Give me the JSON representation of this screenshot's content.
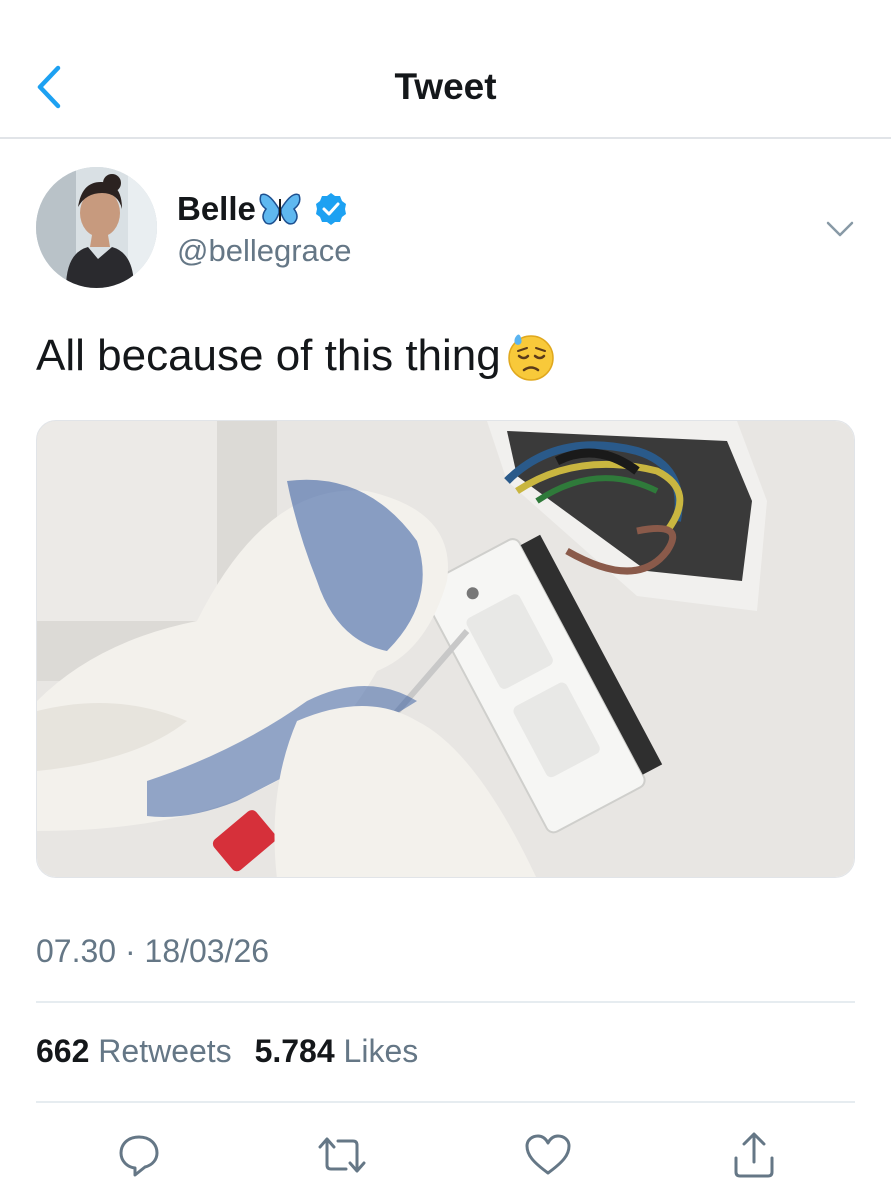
{
  "header": {
    "title": "Tweet"
  },
  "author": {
    "display_name": "Belle",
    "handle": "@bellegrace",
    "verified": true
  },
  "tweet": {
    "text": "All because of this thing",
    "emoji": "downcast-face-with-sweat",
    "timestamp": "07.30 · 18/03/26"
  },
  "stats": {
    "retweets_count": "662",
    "retweets_label": "Retweets",
    "likes_count": "5.784",
    "likes_label": "Likes"
  },
  "actions": {
    "reply_icon": "reply-icon",
    "retweet_icon": "retweet-icon",
    "like_icon": "heart-icon",
    "share_icon": "share-icon"
  },
  "colors": {
    "accent": "#1da1f2",
    "text": "#14171a",
    "secondary": "#657786",
    "divider": "#e6ecf0"
  }
}
